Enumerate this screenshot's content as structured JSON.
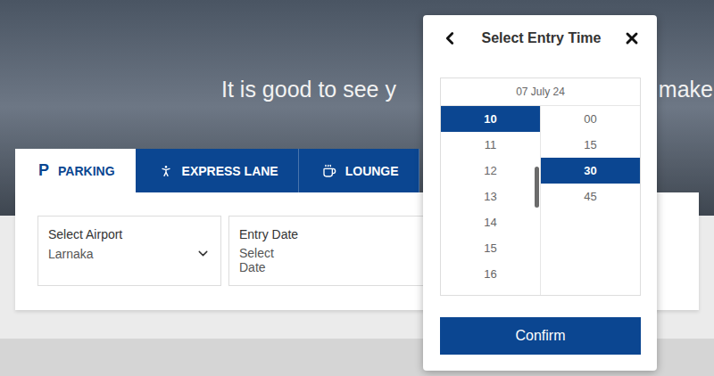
{
  "hero": {
    "heading_left": "It is good to see y",
    "heading_right": "make"
  },
  "tabs": [
    {
      "label": "PARKING",
      "kind": "letter",
      "glyph": "P",
      "selected": true
    },
    {
      "label": "EXPRESS LANE",
      "kind": "express",
      "selected": false
    },
    {
      "label": "LOUNGE",
      "kind": "lounge",
      "selected": false
    }
  ],
  "fields": [
    {
      "label": "Select Airport",
      "value": "Larnaka",
      "kind": "dropdown"
    },
    {
      "label": "Entry Date",
      "value": "Select Date",
      "kind": "date"
    }
  ],
  "modal": {
    "title": "Select Entry Time",
    "date": "07 July 24",
    "hours": [
      {
        "label": "10",
        "selected": true
      },
      {
        "label": "11",
        "selected": false
      },
      {
        "label": "12",
        "selected": false
      },
      {
        "label": "13",
        "selected": false
      },
      {
        "label": "14",
        "selected": false
      },
      {
        "label": "15",
        "selected": false
      },
      {
        "label": "16",
        "selected": false
      }
    ],
    "minutes": [
      {
        "label": "00",
        "selected": false
      },
      {
        "label": "15",
        "selected": false
      },
      {
        "label": "30",
        "selected": true
      },
      {
        "label": "45",
        "selected": false
      }
    ],
    "confirm": "Confirm"
  }
}
